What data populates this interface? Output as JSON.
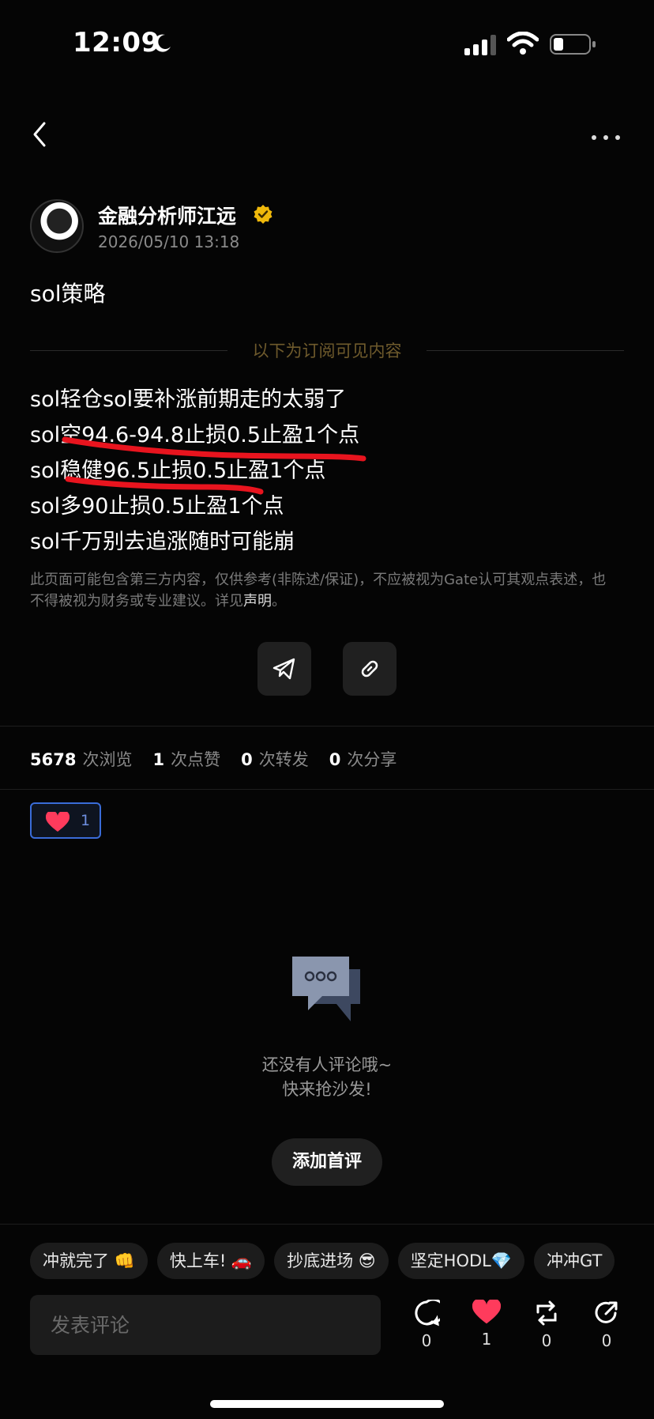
{
  "status_bar": {
    "time": "12:09"
  },
  "author": {
    "name": "金融分析师江远",
    "post_time": "2026/05/10 13:18"
  },
  "post": {
    "title": "sol策略",
    "subscription_divider": "以下为订阅可见内容",
    "lines": [
      "sol轻仓sol要补涨前期走的太弱了",
      "sol空94.6-94.8止损0.5止盈1个点",
      "sol稳健96.5止损0.5止盈1个点",
      "sol多90止损0.5止盈1个点",
      "sol千万别去追涨随时可能崩"
    ],
    "disclaimer": "此页面可能包含第三方内容，仅供参考(非陈述/保证)，不应被视为Gate认可其观点表述，也不得被视为财务或专业建议。详见",
    "disclaimer_link": "声明",
    "disclaimer_end": "。"
  },
  "stats": {
    "views": "5678",
    "views_label": "次浏览",
    "likes": "1",
    "likes_label": "次点赞",
    "reposts": "0",
    "reposts_label": "次转发",
    "shares": "0",
    "shares_label": "次分享"
  },
  "reaction": {
    "count": "1"
  },
  "comments": {
    "empty_line1": "还没有人评论哦~",
    "empty_line2": "快来抢沙发!",
    "add_first": "添加首评"
  },
  "quick_replies": [
    "冲就完了 👊",
    "快上车! 🚗",
    "抄底进场 😎",
    "坚定HODL💎",
    "冲冲GT"
  ],
  "comment_input": {
    "placeholder": "发表评论"
  },
  "actions": {
    "comment_count": "0",
    "like_count": "1",
    "repost_count": "0",
    "share_count": "0"
  },
  "colors": {
    "accent_like": "#ff3b5c",
    "annotation": "#e8141e",
    "verified": "#f0b90b",
    "reaction_border": "#3a6cd8"
  }
}
